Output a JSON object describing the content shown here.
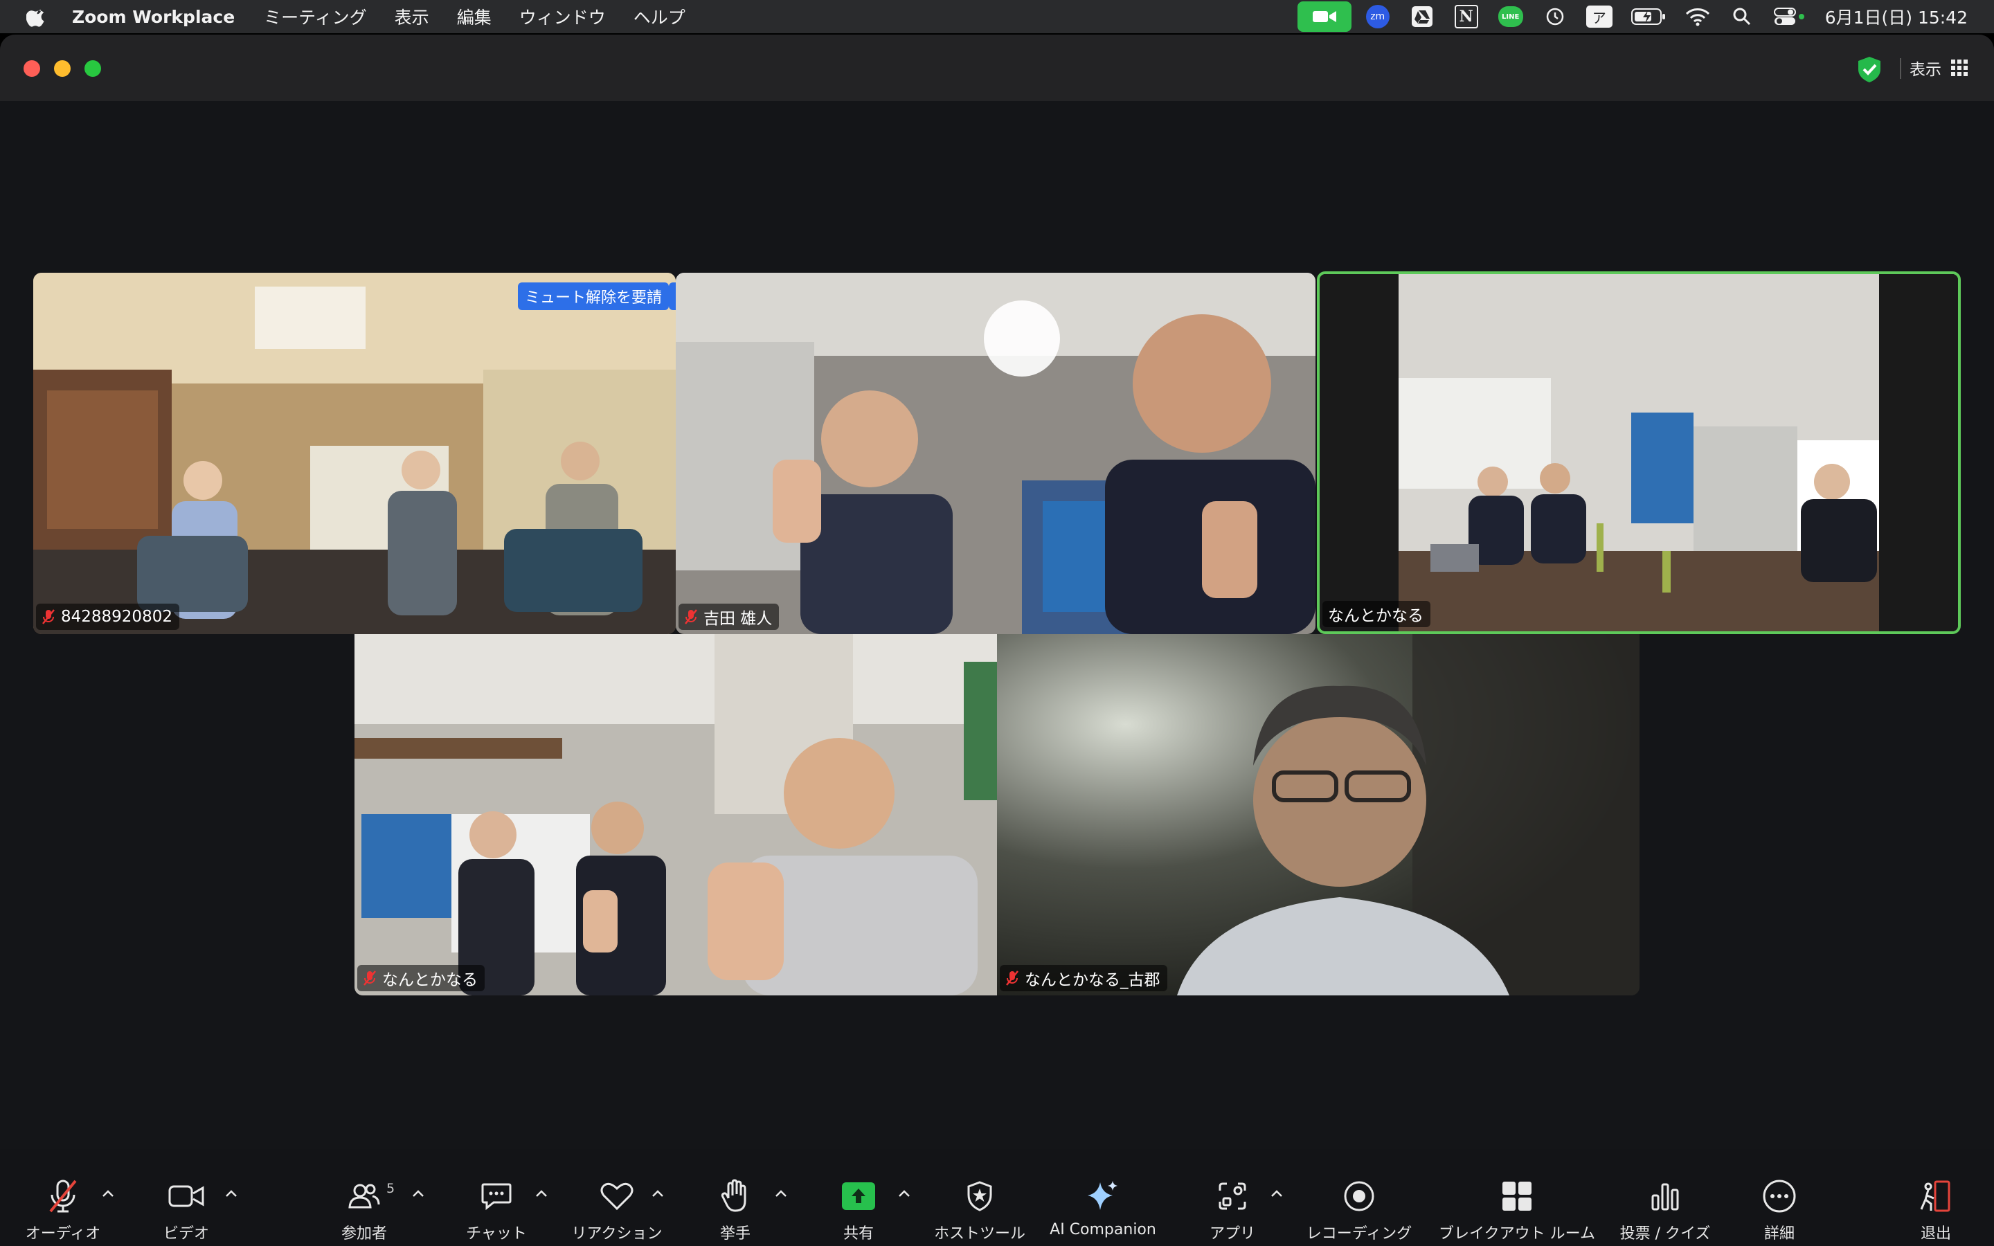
{
  "menubar": {
    "app_name": "Zoom Workplace",
    "menus": [
      "ミーティング",
      "表示",
      "編集",
      "ウィンドウ",
      "ヘルプ"
    ],
    "tray_icons": [
      "zoom-video-icon",
      "zm-icon",
      "drive-icon",
      "notion-icon",
      "line-icon",
      "clock-icon",
      "input-method-icon",
      "battery-icon",
      "wifi-icon",
      "search-icon",
      "control-center-icon"
    ],
    "input_method": "ア",
    "notion_letter": "N",
    "zm_letters": "zm",
    "line_letters": "LINE",
    "clock": "6月1日(日)  15:42"
  },
  "window": {
    "view_label": "表示",
    "accent_active": "#5ec95a"
  },
  "participants": [
    {
      "name": "84288920802",
      "muted": true,
      "active_speaker": false
    },
    {
      "name": "吉田 雄人",
      "muted": true,
      "active_speaker": false
    },
    {
      "name": "なんとかなる",
      "muted": false,
      "active_speaker": true
    },
    {
      "name": "なんとかなる",
      "muted": true,
      "active_speaker": false
    },
    {
      "name": "なんとかなる_古郡",
      "muted": true,
      "active_speaker": false
    }
  ],
  "tile_actions": {
    "unmute_request": "ミュート解除を要請",
    "more": "…"
  },
  "toolbar": {
    "audio": "オーディオ",
    "video": "ビデオ",
    "participants": "参加者",
    "participants_count": "5",
    "chat": "チャット",
    "reactions": "リアクション",
    "raise_hand": "挙手",
    "share": "共有",
    "host_tools": "ホストツール",
    "ai_companion": "AI Companion",
    "apps": "アプリ",
    "recording": "レコーディング",
    "breakout": "ブレイクアウト ルーム",
    "polls": "投票 / クイズ",
    "more": "詳細",
    "leave": "退出"
  }
}
